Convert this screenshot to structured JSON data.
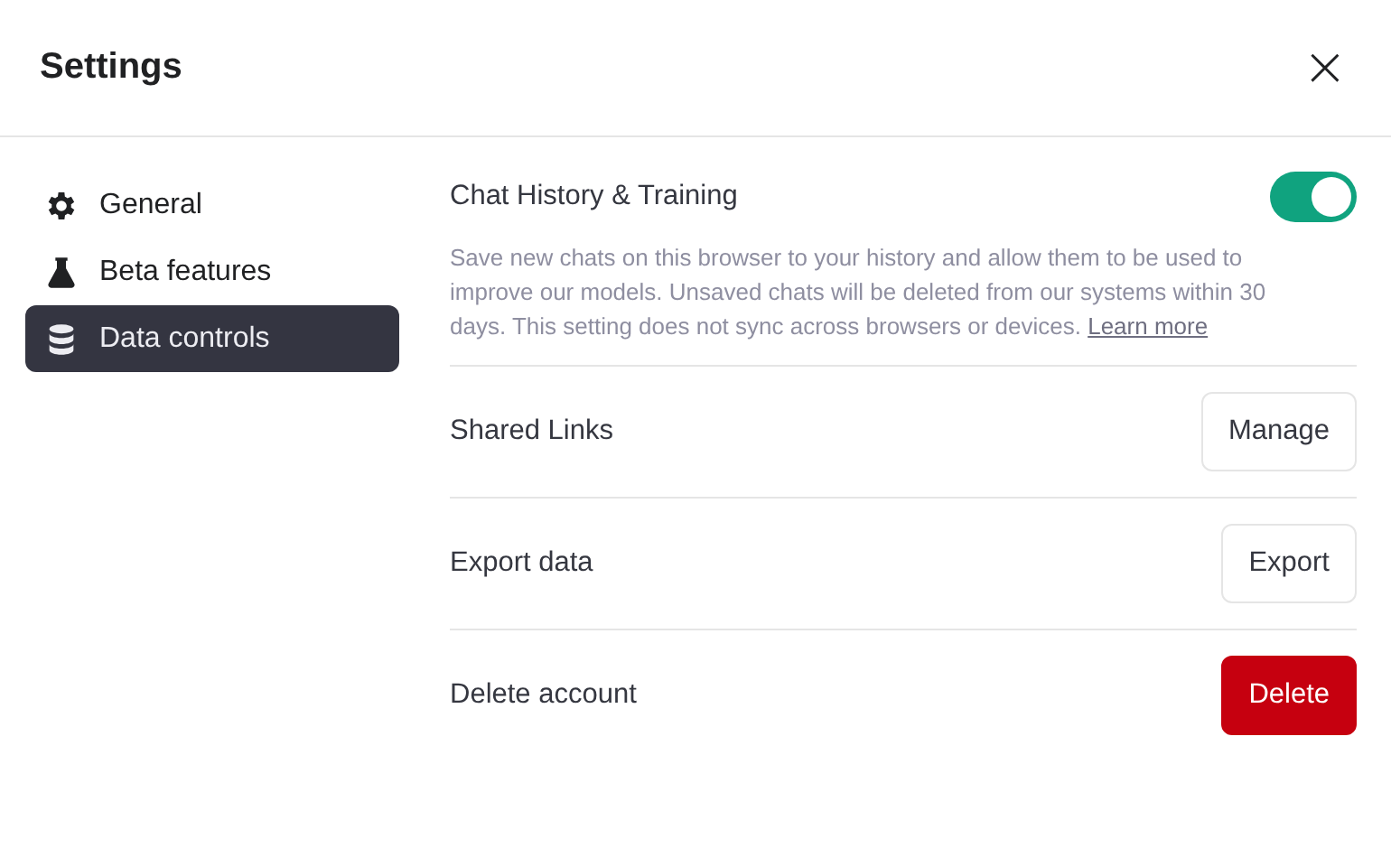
{
  "window": {
    "title": "Settings",
    "close": "×"
  },
  "sidebar": {
    "items": [
      {
        "label": "General",
        "selected": false
      },
      {
        "label": "Beta features",
        "selected": false
      },
      {
        "label": "Data controls",
        "selected": true
      }
    ]
  },
  "rows": [
    {
      "kind": "toggle",
      "label": "Chat History & Training",
      "on": true,
      "description": "Save new chats on this browser to your history and allow them to be used to improve our models. Unsaved chats will be deleted from our systems within 30 days. This setting does not sync across browsers or devices.",
      "link": "Learn more"
    },
    {
      "kind": "button",
      "label": "Shared Links",
      "button": "Manage",
      "danger": false
    },
    {
      "kind": "button",
      "label": "Export data",
      "button": "Export",
      "danger": false
    },
    {
      "kind": "button",
      "label": "Delete account",
      "button": "Delete",
      "danger": true
    }
  ]
}
